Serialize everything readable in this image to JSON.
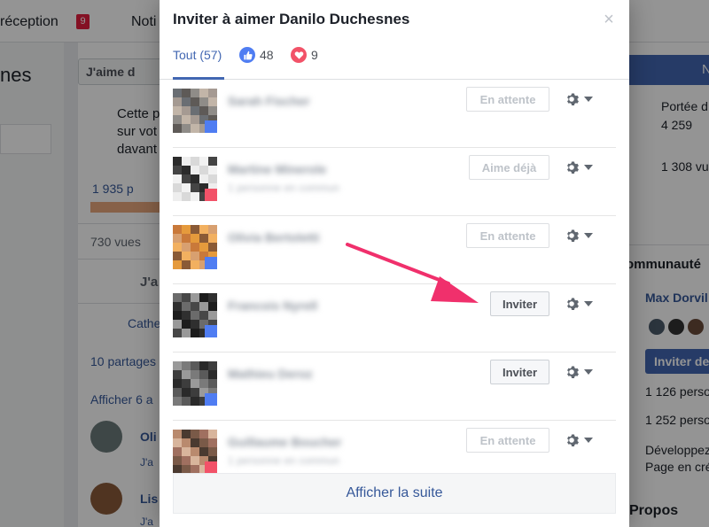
{
  "background": {
    "topbar": {
      "inbox_label": "réception",
      "inbox_badge": "9",
      "notif_label": "Noti"
    },
    "page_name_fragment": "nes",
    "like_button_label": "J'aime d",
    "post_lines": [
      "Cette p",
      "sur vot",
      "davant"
    ],
    "stats": {
      "people": "1 935 p",
      "views": "730 vues"
    },
    "like_action": "J'a",
    "reactions_name": "Cathe",
    "shares": "10 partages",
    "show_more": "Afficher 6 a",
    "comments": [
      {
        "name": "Oli",
        "action": "J'a"
      },
      {
        "name": "Lis",
        "action": "J'a"
      }
    ],
    "right": {
      "top_button": "N",
      "reach_label": "Portée d",
      "reach_value": "4 259",
      "views_value": "1 308 vu",
      "community_title": "ommunauté",
      "member_name": "Max Dorvil",
      "invite_button": "Inviter de",
      "likes_count": "1 126 perso",
      "follows_count": "1 252 perso",
      "develop_line1": "Développez",
      "develop_line2": "Page en cré",
      "about": "Propos"
    }
  },
  "dialog": {
    "title": "Inviter à aimer Danilo Duchesnes",
    "close_symbol": "×",
    "tabs": [
      {
        "label": "Tout (57)",
        "icon": ""
      },
      {
        "label": "48",
        "icon": "like-icon"
      },
      {
        "label": "9",
        "icon": "love-icon"
      }
    ],
    "rows": [
      {
        "name": "Sarah Fischer",
        "sub": "",
        "reaction": "like",
        "button": "En attente",
        "state": "disabled"
      },
      {
        "name": "Martine Minerole",
        "sub": "1 personne en commun",
        "reaction": "love",
        "button": "Aime déjà",
        "state": "disabled"
      },
      {
        "name": "Olivia Bertoletti",
        "sub": "",
        "reaction": "like",
        "button": "En attente",
        "state": "disabled"
      },
      {
        "name": "Francois Nyrell",
        "sub": "",
        "reaction": "like",
        "button": "Inviter",
        "state": "active"
      },
      {
        "name": "Mathieu Deroz",
        "sub": "",
        "reaction": "like",
        "button": "Inviter",
        "state": "active"
      },
      {
        "name": "Guillaume Boucher",
        "sub": "1 personne en commun",
        "reaction": "love",
        "button": "En attente",
        "state": "disabled"
      }
    ],
    "show_more": "Afficher la suite"
  },
  "colors": {
    "accent": "#4267b2",
    "like": "#4f7df2",
    "love": "#f25268",
    "arrow": "#f0306c"
  }
}
